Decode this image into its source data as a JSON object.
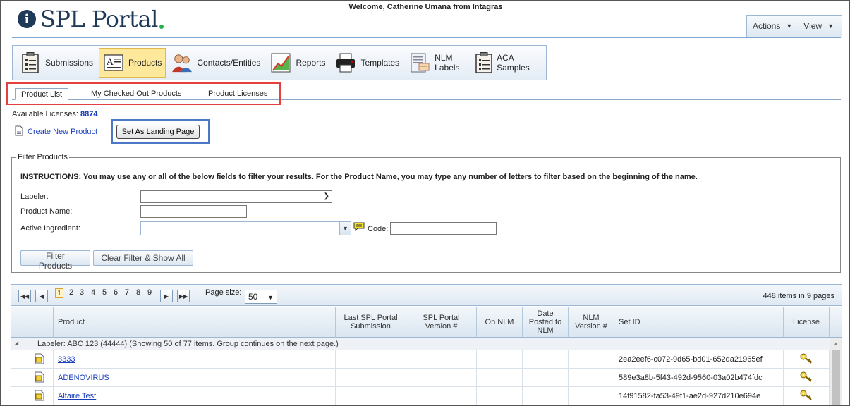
{
  "header": {
    "logo_text": "SPL Portal",
    "welcome": "Welcome, Catherine Umana from Intagras",
    "menu": [
      {
        "label": "Actions"
      },
      {
        "label": "View"
      }
    ]
  },
  "toolbar": {
    "items": [
      {
        "label": "Submissions",
        "icon": "clipboard-icon",
        "active": false
      },
      {
        "label": "Products",
        "icon": "document-icon",
        "active": true
      },
      {
        "label": "Contacts/Entities",
        "icon": "people-icon",
        "active": false
      },
      {
        "label": "Reports",
        "icon": "chart-icon",
        "active": false
      },
      {
        "label": "Templates",
        "icon": "printer-icon",
        "active": false
      },
      {
        "label": "NLM Labels",
        "icon": "label-icon",
        "active": false
      },
      {
        "label": "ACA Samples",
        "icon": "clipboard-icon",
        "active": false
      }
    ]
  },
  "tabs": [
    {
      "label": "Product List",
      "active": true
    },
    {
      "label": "My Checked Out Products",
      "active": false
    },
    {
      "label": "Product Licenses",
      "active": false
    }
  ],
  "licenses": {
    "label": "Available Licenses:",
    "value": "8874"
  },
  "actions": {
    "create_label": "Create New Product",
    "landing_label": "Set As Landing Page"
  },
  "filter": {
    "legend": "Filter Products",
    "instructions": "INSTRUCTIONS: You may use any or all of the below fields to filter your results. For the Product Name, you may type any number of letters to filter based on the beginning of the name.",
    "labeler_label": "Labeler:",
    "labeler_value": "",
    "product_name_label": "Product Name:",
    "product_name_value": "",
    "ingredient_label": "Active Ingredient:",
    "ingredient_value": "",
    "code_label": "Code:",
    "code_value": "",
    "filter_button": "Filter Products",
    "clear_button": "Clear Filter & Show All"
  },
  "pager": {
    "pages": [
      "1",
      "2",
      "3",
      "4",
      "5",
      "6",
      "7",
      "8",
      "9"
    ],
    "current_page": "1",
    "page_size_label": "Page size:",
    "page_size": "50",
    "info": "448 items in 9 pages"
  },
  "grid": {
    "columns": [
      "Product",
      "Last SPL Portal Submission",
      "SPL Portal Version #",
      "On NLM",
      "Date Posted to NLM",
      "NLM Version #",
      "Set ID",
      "License"
    ],
    "group_label": "Labeler: ABC 123 (44444) (Showing 50 of 77 items. Group continues on the next page.)",
    "rows": [
      {
        "product": "3333",
        "set_id": "2ea2eef6-c072-9d65-bd01-652da21965ef"
      },
      {
        "product": "ADENOVIRUS",
        "set_id": "589e3a8b-5f43-492d-9560-03a02b474fdc"
      },
      {
        "product": "Altaire Test",
        "set_id": "14f91582-fa53-49f1-ae2d-927d210e694e"
      }
    ]
  }
}
